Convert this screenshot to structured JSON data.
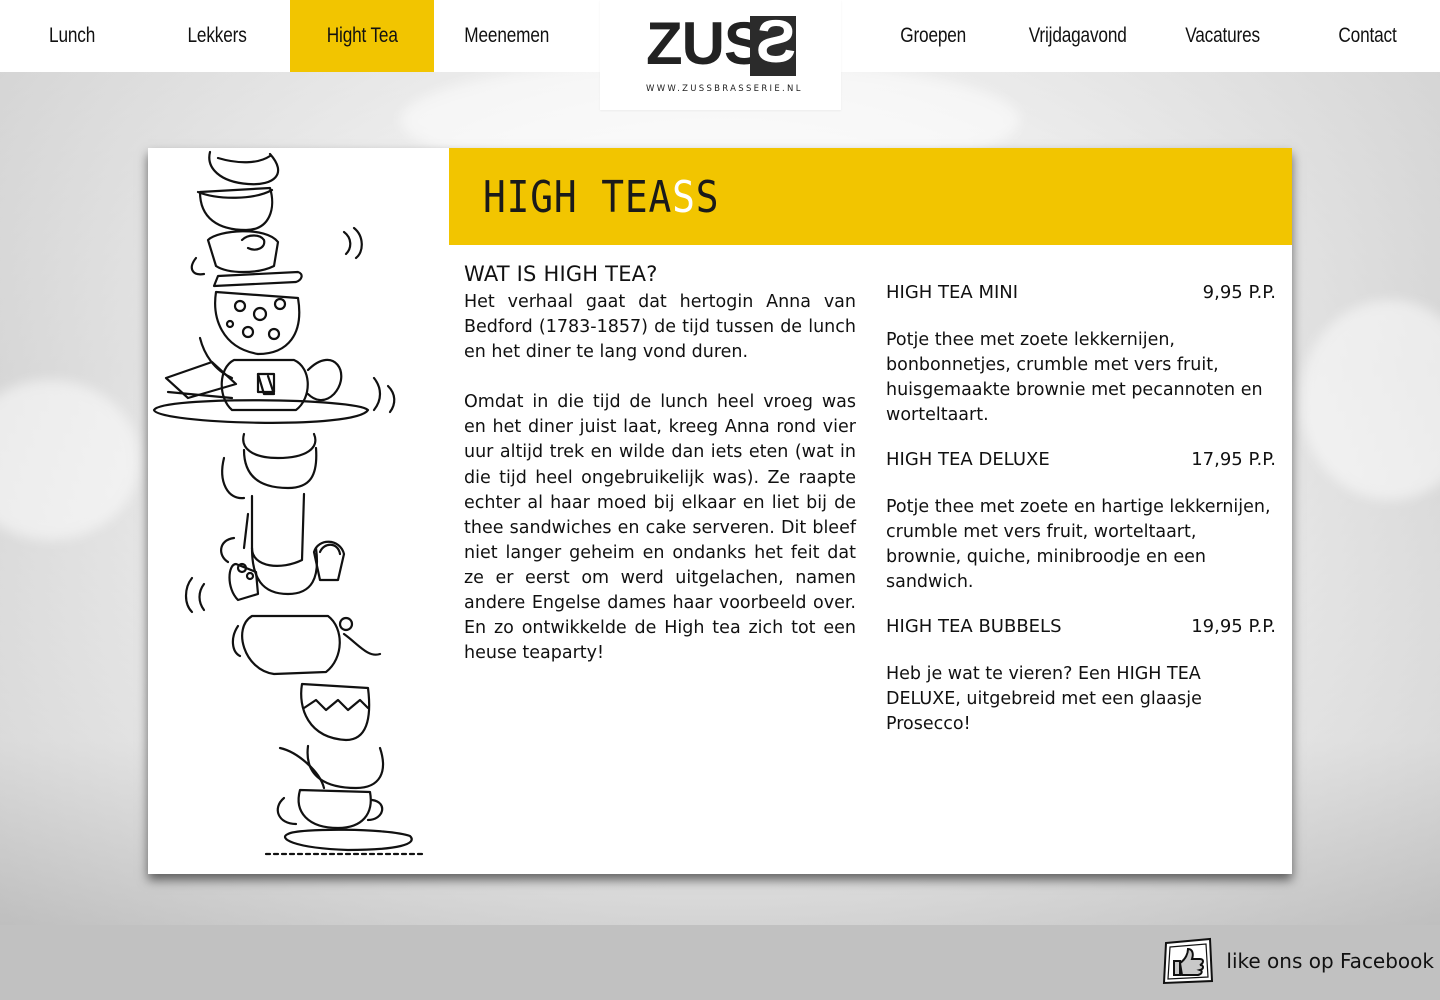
{
  "nav": {
    "left": [
      {
        "label": "Lunch",
        "active": false
      },
      {
        "label": "Lekkers",
        "active": false
      },
      {
        "label": "Hight Tea",
        "active": true
      },
      {
        "label": "Meenemen",
        "active": false
      }
    ],
    "right": [
      {
        "label": "Groepen",
        "active": false
      },
      {
        "label": "Vrijdagavond",
        "active": false
      },
      {
        "label": "Vacatures",
        "active": false
      },
      {
        "label": "Contact",
        "active": false
      }
    ]
  },
  "logo": {
    "word": "ZUS",
    "mirrored_letter": "S",
    "url": "WWW.ZUSSBRASSERIE.NL"
  },
  "banner": {
    "title": "HIGH TEA",
    "title_tail": "S",
    "title_end": "S"
  },
  "story": {
    "title": "WAT IS HIGH TEA?",
    "p1": "Het verhaal gaat dat hertogin Anna van Bedford (1783-1857) de tijd tussen de lunch en het diner te lang vond duren.",
    "p2": "Omdat in die tijd de lunch heel vroeg was en het diner juist laat, kreeg Anna rond vier uur altijd trek en wilde dan iets eten (wat in die tijd heel ongebruikelijk was). Ze raapte echter al haar moed bij elkaar en liet bij de thee sandwiches en cake serveren. Dit bleef niet langer geheim en ondanks het feit dat ze er eerst om werd uitgelachen, namen andere Engelse dames haar voorbeeld over. En zo ontwikkelde de High tea zich tot een heuse teaparty!"
  },
  "menu": [
    {
      "name": "HIGH TEA MINI",
      "price": "9,95 P.P.",
      "desc": "Potje thee met zoete lekkernijen, bonbonnetjes, crumble met vers fruit, huisgemaakte brownie met pecannoten en worteltaart."
    },
    {
      "name": "HIGH TEA DELUXE",
      "price": "17,95 P.P.",
      "desc": "Potje thee met zoete en hartige lekkernijen, crumble met vers fruit, worteltaart, brownie, quiche, minibroodje en een sandwich."
    },
    {
      "name": "HIGH TEA BUBBELS",
      "price": "19,95 P.P.",
      "desc": "Heb je wat te vieren? Een HIGH TEA DELUXE, uitgebreid met een glaasje Prosecco!"
    }
  ],
  "footer": {
    "facebook_label": "like ons op Facebook"
  },
  "colors": {
    "accent": "#f2c500",
    "footer": "#c1c1c1",
    "text": "#111111"
  }
}
